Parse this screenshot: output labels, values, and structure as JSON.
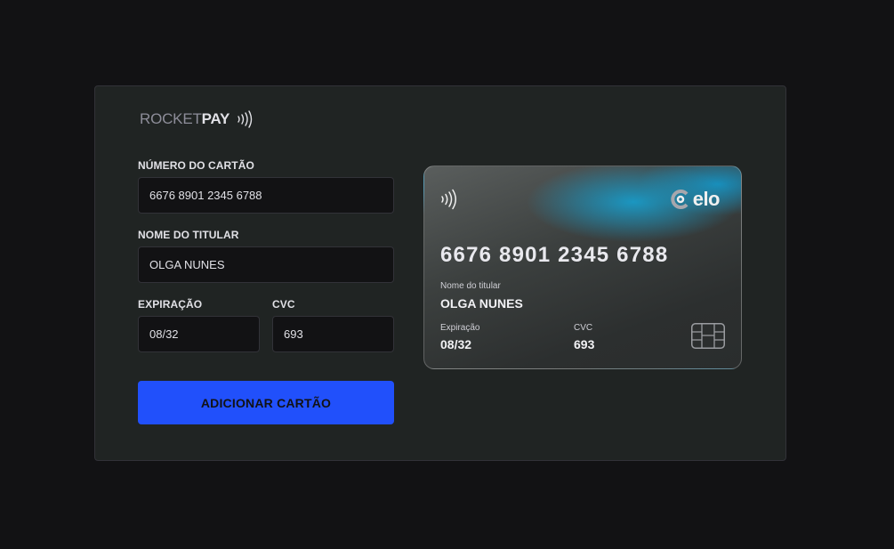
{
  "brand": {
    "light": "ROCKET",
    "bold": "PAY"
  },
  "form": {
    "card_number_label": "NÚMERO DO CARTÃO",
    "card_number_value": "6676 8901 2345 6788",
    "holder_label": "NOME DO TITULAR",
    "holder_value": "OLGA NUNES",
    "expiration_label": "EXPIRAÇÃO",
    "expiration_value": "08/32",
    "cvc_label": "CVC",
    "cvc_value": "693",
    "submit_label": "ADICIONAR CARTÃO"
  },
  "card": {
    "brand_name": "elo",
    "number": "6676 8901 2345 6788",
    "holder_label": "Nome do titular",
    "holder_value": "OLGA NUNES",
    "expiration_label": "Expiração",
    "expiration_value": "08/32",
    "cvc_label": "CVC",
    "cvc_value": "693"
  },
  "colors": {
    "background": "#121214",
    "panel": "#202423",
    "accent": "#2150fb",
    "card_glow": "#1a9bc8"
  },
  "icons": [
    "contactless-icon",
    "elo-logo-icon",
    "chip-icon"
  ]
}
